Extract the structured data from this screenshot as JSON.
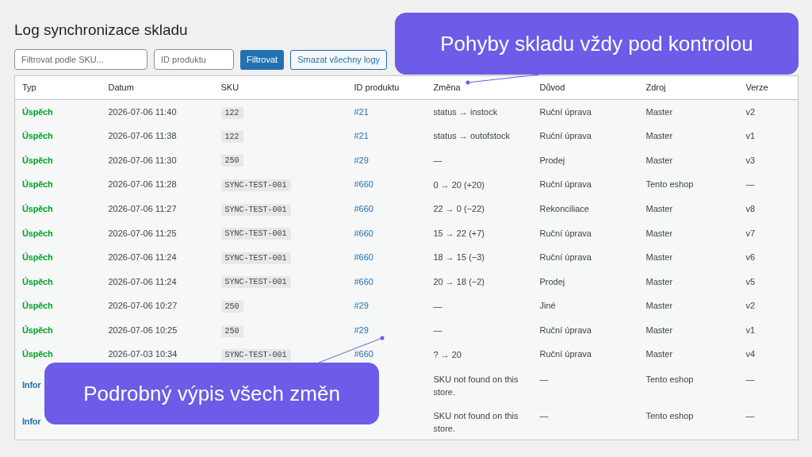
{
  "title": "Log synchronizace skladu",
  "filters": {
    "sku": {
      "placeholder": "Filtrovat podle SKU..."
    },
    "product_id": {
      "placeholder": "ID produktu"
    },
    "filter_button": "Filtrovat",
    "clear_button": "Smazat všechny logy"
  },
  "table": {
    "columns": [
      "Typ",
      "Datum",
      "SKU",
      "ID produktu",
      "Změna",
      "Důvod",
      "Zdroj",
      "Verze"
    ],
    "rows": [
      {
        "kind": "success",
        "type": "Úspěch",
        "date": "2026-07-06 11:40",
        "sku": "122",
        "product": "#21",
        "change": "status → instock",
        "reason": "Ruční úprava",
        "source": "Master",
        "version": "v2"
      },
      {
        "kind": "success",
        "type": "Úspěch",
        "date": "2026-07-06 11:38",
        "sku": "122",
        "product": "#21",
        "change": "status → outofstock",
        "reason": "Ruční úprava",
        "source": "Master",
        "version": "v1"
      },
      {
        "kind": "success",
        "type": "Úspěch",
        "date": "2026-07-06 11:30",
        "sku": "250",
        "product": "#29",
        "change": "—",
        "reason": "Prodej",
        "source": "Master",
        "version": "v3"
      },
      {
        "kind": "success",
        "type": "Úspěch",
        "date": "2026-07-06 11:28",
        "sku": "SYNC-TEST-001",
        "product": "#660",
        "change": "0 → 20 (+20)",
        "reason": "Ruční úprava",
        "source": "Tento eshop",
        "version": "—"
      },
      {
        "kind": "success",
        "type": "Úspěch",
        "date": "2026-07-06 11:27",
        "sku": "SYNC-TEST-001",
        "product": "#660",
        "change": "22 → 0 (−22)",
        "reason": "Rekonciliace",
        "source": "Master",
        "version": "v8"
      },
      {
        "kind": "success",
        "type": "Úspěch",
        "date": "2026-07-06 11:25",
        "sku": "SYNC-TEST-001",
        "product": "#660",
        "change": "15 → 22 (+7)",
        "reason": "Ruční úprava",
        "source": "Master",
        "version": "v7"
      },
      {
        "kind": "success",
        "type": "Úspěch",
        "date": "2026-07-06 11:24",
        "sku": "SYNC-TEST-001",
        "product": "#660",
        "change": "18 → 15 (−3)",
        "reason": "Ruční úprava",
        "source": "Master",
        "version": "v6"
      },
      {
        "kind": "success",
        "type": "Úspěch",
        "date": "2026-07-06 11:24",
        "sku": "SYNC-TEST-001",
        "product": "#660",
        "change": "20 → 18 (−2)",
        "reason": "Prodej",
        "source": "Master",
        "version": "v5"
      },
      {
        "kind": "success",
        "type": "Úspěch",
        "date": "2026-07-06 10:27",
        "sku": "250",
        "product": "#29",
        "change": "—",
        "reason": "Jiné",
        "source": "Master",
        "version": "v2"
      },
      {
        "kind": "success",
        "type": "Úspěch",
        "date": "2026-07-06 10:25",
        "sku": "250",
        "product": "#29",
        "change": "—",
        "reason": "Ruční úprava",
        "source": "Master",
        "version": "v1"
      },
      {
        "kind": "success",
        "type": "Úspěch",
        "date": "2026-07-03 10:34",
        "sku": "SYNC-TEST-001",
        "product": "#660",
        "change": "? → 20",
        "reason": "Ruční úprava",
        "source": "Master",
        "version": "v4"
      },
      {
        "kind": "info",
        "type": "Infor",
        "change": "SKU not found on this store.",
        "reason": "—",
        "source": "Tento eshop",
        "version": "—"
      },
      {
        "kind": "info",
        "type": "Infor",
        "change": "SKU not found on this store.",
        "reason": "—",
        "source": "Tento eshop",
        "version": "—"
      }
    ]
  },
  "callouts": [
    "Pohyby skladu vždy pod kontrolou",
    "Podrobný výpis všech změn"
  ]
}
